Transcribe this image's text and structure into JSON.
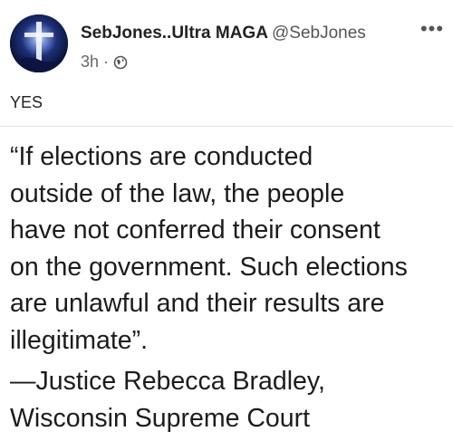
{
  "post": {
    "author_name": "SebJones..Ultra MAGA",
    "author_handle": "@SebJones",
    "time": "3h",
    "separator": "·",
    "more_label": "•••",
    "text": "YES"
  },
  "image_text": {
    "quote_lines": [
      "“If elections are conducted",
      "outside of the law, the people",
      "have not conferred their consent",
      "on the government. Such elections",
      "are unlawful and their results are",
      "illegitimate”."
    ],
    "attribution_lines": [
      "—Justice Rebecca Bradley,",
      "Wisconsin Supreme Court"
    ]
  },
  "icons": {
    "avatar": "avatar-cross-image",
    "visibility": "globe-icon",
    "more": "more-dots-icon"
  },
  "colors": {
    "background": "#ffffff",
    "text": "#1c1c1c",
    "muted": "#555555",
    "avatar_bg": "#0c1a4a"
  }
}
